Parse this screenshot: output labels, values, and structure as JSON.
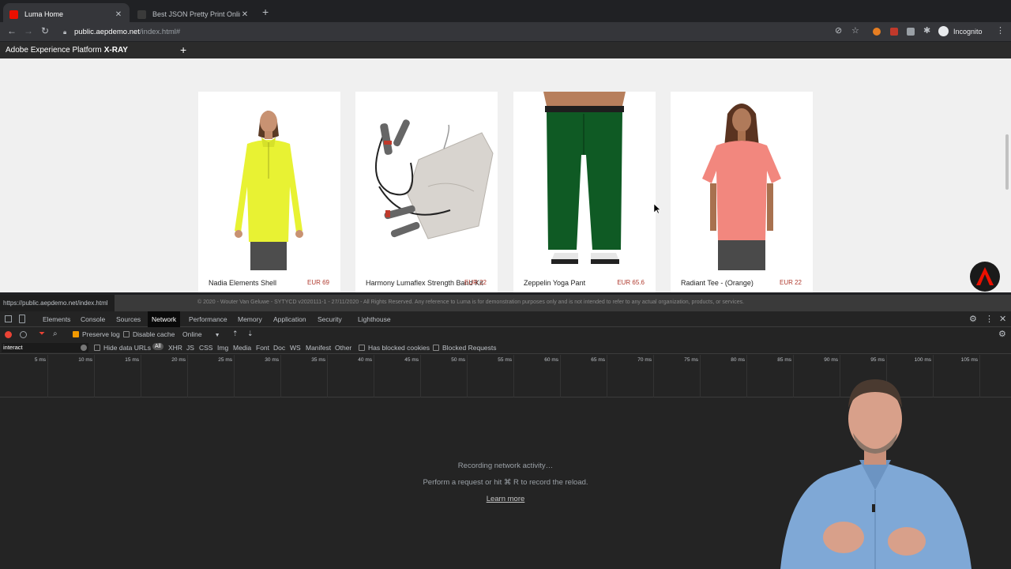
{
  "browser": {
    "tabs": [
      {
        "title": "Luma Home",
        "favicon_color": "#eb1000"
      },
      {
        "title": "Best JSON Pretty Print Online",
        "favicon_color": "#3a3a3a"
      }
    ],
    "address": {
      "host": "public.aepdemo.net",
      "path": "/index.html#"
    },
    "profile_label": "Incognito"
  },
  "xray": {
    "prefix": "Adobe Experience Platform",
    "brand": "X-RAY"
  },
  "products": [
    {
      "name": "Nadia Elements Shell",
      "price": "EUR 69"
    },
    {
      "name": "Harmony Lumaflex Strength Band Kit",
      "price": "EUR 22"
    },
    {
      "name": "Zeppelin Yoga Pant",
      "price": "EUR 65.6"
    },
    {
      "name": "Radiant Tee - (Orange)",
      "price": "EUR 22"
    }
  ],
  "status_url": "https://public.aepdemo.net/index.html",
  "footer_text": "© 2020 - Wouter Van Geluwe - SYTYCD v2020111-1 - 27/11/2020 - All Rights Reserved. Any reference to Luma is for demonstration purposes only and is not intended to refer to any actual organization, products, or services.",
  "devtools": {
    "tabs": [
      "Elements",
      "Console",
      "Sources",
      "Network",
      "Performance",
      "Memory",
      "Application",
      "Security",
      "Lighthouse"
    ],
    "active_tab": "Network",
    "preserve_log": "Preserve log",
    "disable_cache": "Disable cache",
    "throttle": "Online",
    "filter_value": "interact",
    "hide_data_urls": "Hide data URLs",
    "type_filters": [
      "All",
      "XHR",
      "JS",
      "CSS",
      "Img",
      "Media",
      "Font",
      "Doc",
      "WS",
      "Manifest",
      "Other"
    ],
    "has_blocked_cookies": "Has blocked cookies",
    "blocked_requests": "Blocked Requests",
    "timeline_ticks": [
      "5 ms",
      "10 ms",
      "15 ms",
      "20 ms",
      "25 ms",
      "30 ms",
      "35 ms",
      "40 ms",
      "45 ms",
      "50 ms",
      "55 ms",
      "60 ms",
      "65 ms",
      "70 ms",
      "75 ms",
      "80 ms",
      "85 ms",
      "90 ms",
      "95 ms",
      "100 ms",
      "105 ms"
    ],
    "empty_line1": "Recording network activity…",
    "empty_line2": "Perform a request or hit ⌘ R to record the reload.",
    "empty_link": "Learn more"
  },
  "colors": {
    "accent_red": "#eb1000",
    "price_red": "#b03a2e",
    "devtools_bg": "#242424"
  }
}
